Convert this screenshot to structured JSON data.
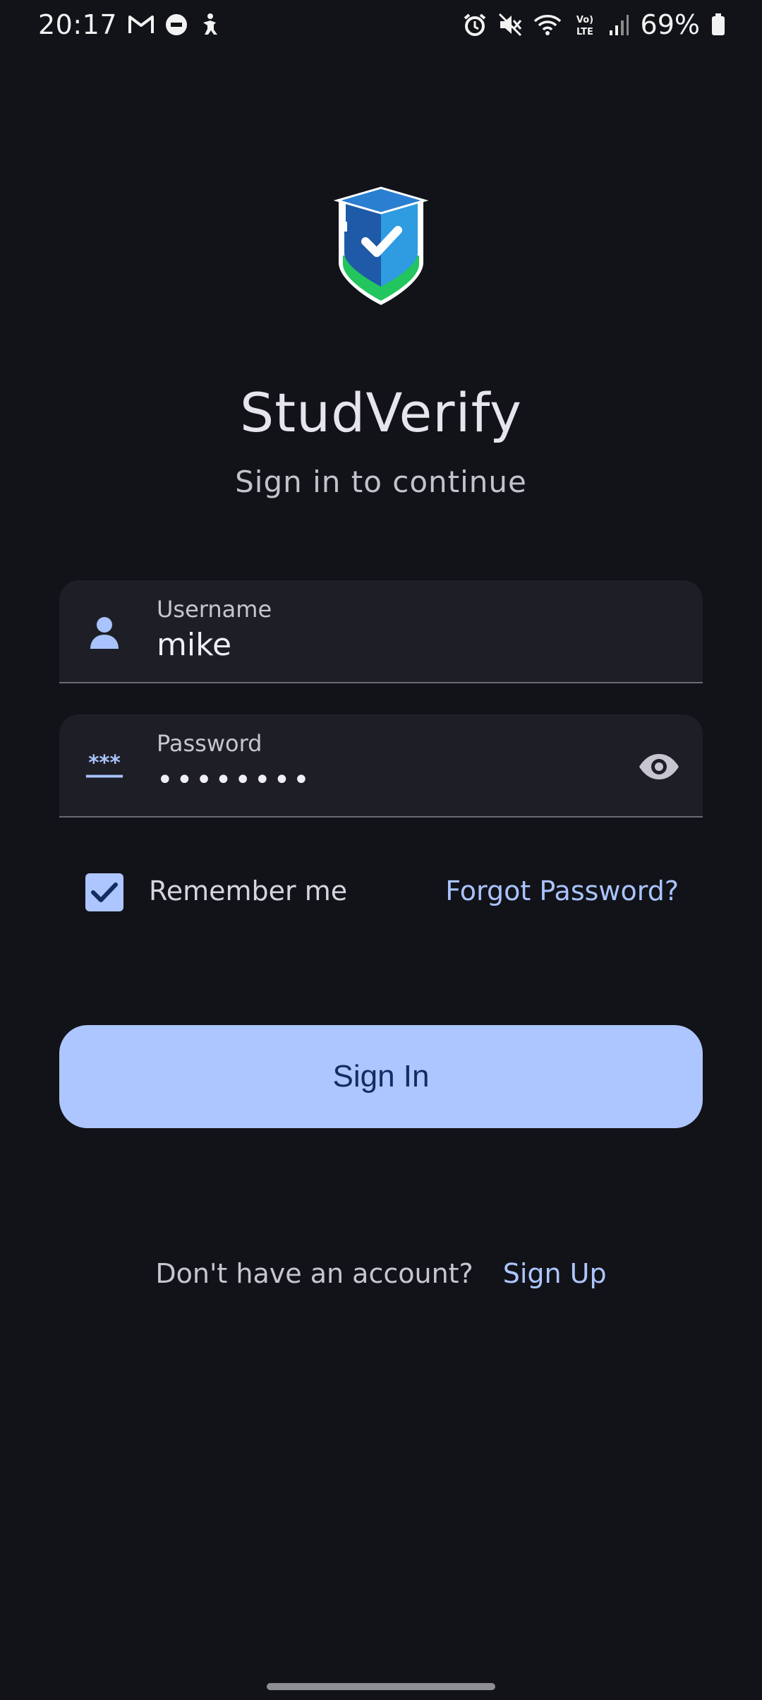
{
  "status_bar": {
    "time": "20:17",
    "battery": "69%",
    "icons_left": [
      "gmail-icon",
      "do-not-disturb-icon",
      "accessibility-icon"
    ],
    "icons_right": [
      "alarm-icon",
      "mute-icon",
      "wifi-icon",
      "volte-icon",
      "signal-icon",
      "battery-icon"
    ]
  },
  "app": {
    "title": "StudVerify",
    "subtitle": "Sign in to continue",
    "logo_icon": "graduation-shield-check-icon"
  },
  "form": {
    "username": {
      "label": "Username",
      "value": "mike",
      "icon": "person-icon"
    },
    "password": {
      "label": "Password",
      "value": "••••••••",
      "icon": "password-icon",
      "toggle_icon": "eye-icon"
    },
    "remember_me": {
      "label": "Remember me",
      "checked": true
    },
    "forgot_password": "Forgot Password?",
    "submit_label": "Sign In"
  },
  "footer": {
    "prompt": "Don't have an account?",
    "signup_label": "Sign Up"
  },
  "colors": {
    "background": "#121318",
    "field_bg": "#1e1f26",
    "accent": "#adc6ff",
    "button_text": "#102f60"
  }
}
